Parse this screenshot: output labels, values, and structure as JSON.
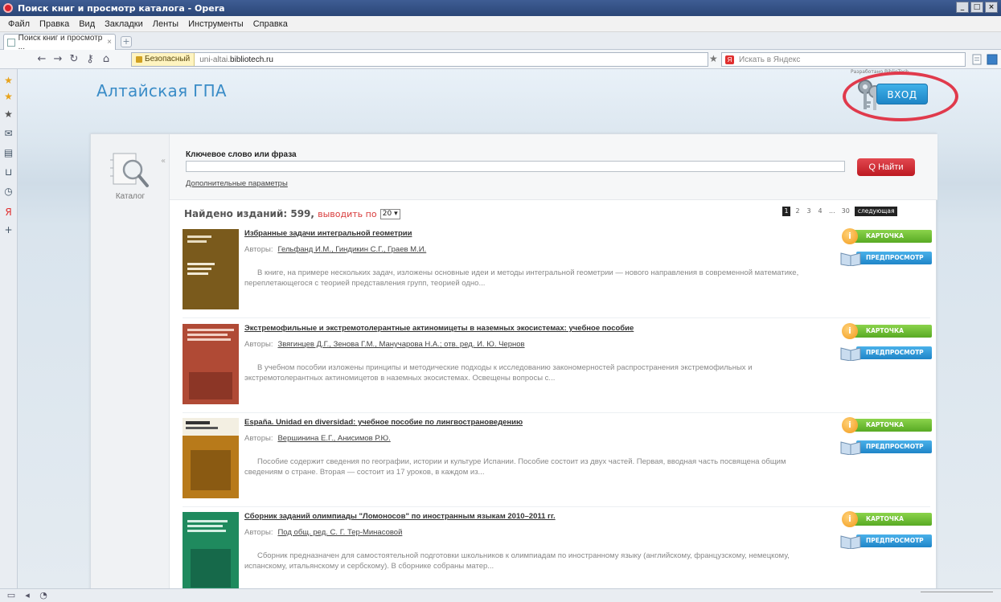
{
  "window": {
    "title": "Поиск книг и просмотр каталога - Opera",
    "controls": [
      "_",
      "□",
      "×"
    ]
  },
  "menu": [
    "Файл",
    "Правка",
    "Вид",
    "Закладки",
    "Ленты",
    "Инструменты",
    "Справка"
  ],
  "tab": {
    "label": "Поиск книг и просмотр ...",
    "close": "×",
    "add": "+"
  },
  "address": {
    "secure_label": "Безопасный",
    "url_prefix": "uni-altai.",
    "url_domain": "bibliotech.ru",
    "search_placeholder": "Искать в Яндекс"
  },
  "site": {
    "title": "Алтайская ГПА",
    "login_label": "ВХОД",
    "note": "Разработано BiblioTech"
  },
  "catalog": {
    "label": "Каталог"
  },
  "search": {
    "keyword_label": "Ключевое слово или фраза",
    "find_label": "Q Найти",
    "advanced_link": "Дополнительные параметры"
  },
  "results": {
    "found_label": "Найдено изданий: 599,",
    "show_label": "выводить по",
    "per_page": "20",
    "pages": [
      "1",
      "2",
      "3",
      "4",
      "...",
      "30"
    ],
    "next_label": "следующая"
  },
  "buttons": {
    "card": "КАРТОЧКА",
    "preview": "ПРЕДПРОСМОТР",
    "info_glyph": "i"
  },
  "authors_label": "Авторы:",
  "items": [
    {
      "title": "Избранные задачи интегральной геометрии",
      "authors": "Гельфанд И.М., Гиндикин С.Г., Граев М.И.",
      "desc": "В книге, на примере нескольких задач, изложены основные идеи и методы интегральной геометрии — нового направления в современной математике, переплетающегося с теорией представления групп, теорией одно...",
      "cover_color": "#7a5a1c"
    },
    {
      "title": "Экстремофильные и экстремотолерантные актиномицеты в наземных экосистемах: учебное пособие",
      "authors": "Звягинцев Д.Г., Зенова Г.М., Манучарова Н.А.; отв. ред. И. Ю. Чернов",
      "desc": "В учебном пособии изложены принципы и методические подходы к исследованию закономерностей распространения экстремофильных и экстремотолерантных актиномицетов в наземных экосистемах. Освещены вопросы с...",
      "cover_color": "#b04a35"
    },
    {
      "title": "España. Unidad en diversidad: учебное пособие по лингвострановедению",
      "authors": "Вершинина Е.Г., Анисимов Р.Ю.",
      "desc": "Пособие содержит сведения по географии, истории и культуре Испании. Пособие состоит из двух частей. Первая, вводная часть посвящена общим сведениям о стране. Вторая — состоит из 17 уроков, в каждом из...",
      "cover_color": "#b87a1a"
    },
    {
      "title": "Сборник заданий олимпиады \"Ломоносов\" по иностранным языкам 2010–2011 гг.",
      "authors": "Под общ. ред. С. Г. Тер-Минасовой",
      "desc": "Сборник предназначен для самостоятельной подготовки школьников к олимпиадам по иностранному языку (английскому, французскому, немецкому, испанскому, итальянскому и сербскому). В сборнике собраны матер...",
      "cover_color": "#1f8a5e"
    }
  ]
}
